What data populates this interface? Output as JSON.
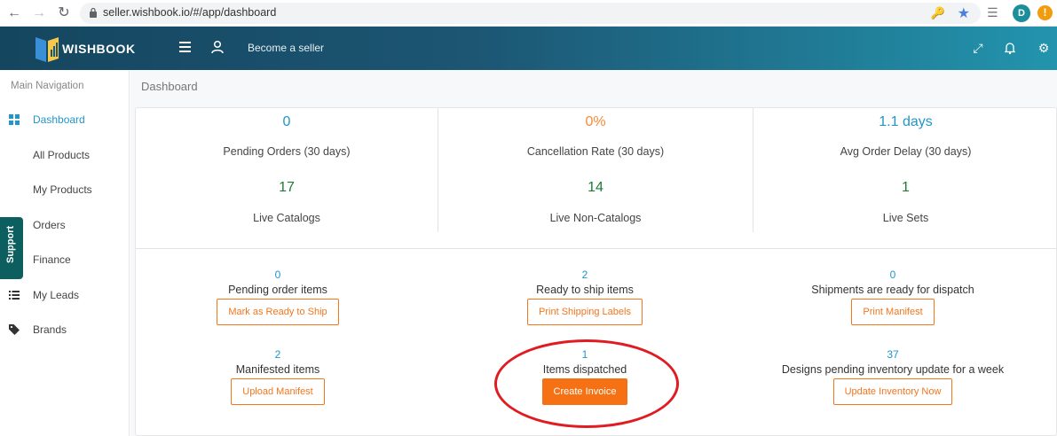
{
  "browser": {
    "url": "seller.wishbook.io/#/app/dashboard",
    "profile_initial": "D",
    "alert_symbol": "!"
  },
  "header": {
    "brand": "WISHBOOK",
    "become_seller": "Become a seller"
  },
  "sidebar": {
    "title": "Main Navigation",
    "support_label": "Support",
    "items": [
      {
        "label": "Dashboard",
        "icon": "dashboard-icon",
        "active": true
      },
      {
        "label": "All Products",
        "icon": "products-icon"
      },
      {
        "label": "My Products",
        "icon": "products-icon"
      },
      {
        "label": "Orders",
        "icon": "cart-icon"
      },
      {
        "label": "Finance",
        "icon": "document-icon"
      },
      {
        "label": "My Leads",
        "icon": "list-icon"
      },
      {
        "label": "Brands",
        "icon": "tag-icon"
      }
    ]
  },
  "main": {
    "breadcrumb": "Dashboard",
    "stats": [
      {
        "value": "0",
        "label": "Pending Orders (30 days)",
        "value2": "17",
        "label2": "Live Catalogs"
      },
      {
        "value": "0%",
        "label": "Cancellation Rate (30 days)",
        "value2": "14",
        "label2": "Live Non-Catalogs"
      },
      {
        "value": "1.1 days",
        "label": "Avg Order Delay (30 days)",
        "value2": "1",
        "label2": "Live Sets"
      }
    ],
    "actions": [
      {
        "count": "0",
        "label": "Pending order items",
        "button": "Mark as Ready to Ship"
      },
      {
        "count": "2",
        "label": "Ready to ship items",
        "button": "Print Shipping Labels"
      },
      {
        "count": "0",
        "label": "Shipments are ready for dispatch",
        "button": "Print Manifest"
      },
      {
        "count": "2",
        "label": "Manifested items",
        "button": "Upload Manifest"
      },
      {
        "count": "1",
        "label": "Items dispatched",
        "button": "Create Invoice"
      },
      {
        "count": "37",
        "label": "Designs pending inventory update for a week",
        "button": "Update Inventory Now"
      }
    ]
  },
  "colors": {
    "accent_orange": "#f57114",
    "link_blue": "#2196c9",
    "highlight_red": "#e11b22"
  }
}
